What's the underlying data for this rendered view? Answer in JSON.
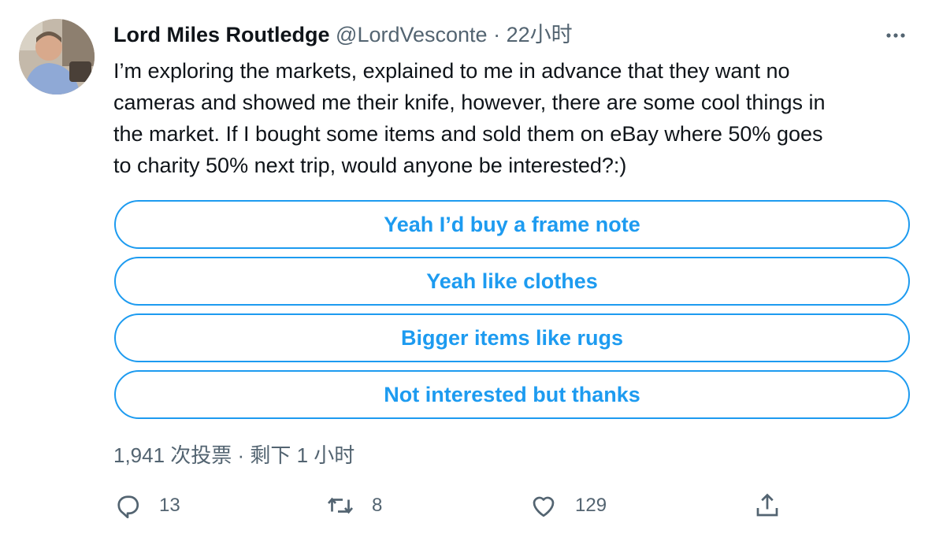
{
  "tweet": {
    "author_name": "Lord Miles Routledge",
    "handle": "@LordVesconte",
    "separator": "·",
    "time": "22小时",
    "text": "I’m exploring the markets, explained to me in advance that they want no\ncameras and showed me their knife, however, there are some cool things in\nthe market. If I bought some items and sold them  on eBay where 50% goes\nto charity 50% next trip, would anyone be interested?:)"
  },
  "poll": {
    "options": [
      {
        "label": "Yeah I’d buy a frame note"
      },
      {
        "label": "Yeah like clothes"
      },
      {
        "label": "Bigger items like rugs"
      },
      {
        "label": "Not interested but thanks"
      }
    ],
    "meta": "1,941 次投票 · 剩下 1 小时"
  },
  "actions": {
    "reply_count": "13",
    "retweet_count": "8",
    "like_count": "129"
  },
  "icons": {
    "more": "more-icon",
    "reply": "reply-icon",
    "retweet": "retweet-icon",
    "like": "heart-icon",
    "share": "share-icon"
  },
  "colors": {
    "accent": "#1d9bf0",
    "secondary_text": "#536471",
    "primary_text": "#0f1419"
  }
}
